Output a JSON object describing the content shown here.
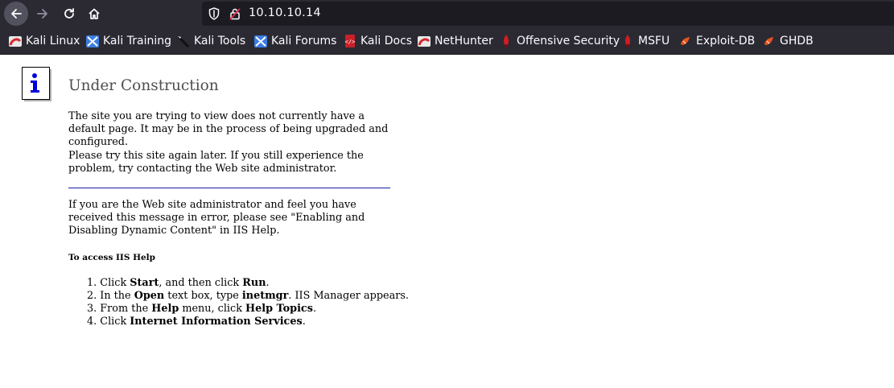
{
  "browser": {
    "url": "10.10.10.14",
    "bookmarks": [
      {
        "label": "Kali Linux",
        "icon": "kali-icon"
      },
      {
        "label": "Kali Training",
        "icon": "kali-training-icon"
      },
      {
        "label": "Kali Tools",
        "icon": "kali-tools-icon"
      },
      {
        "label": "Kali Forums",
        "icon": "kali-forums-icon"
      },
      {
        "label": "Kali Docs",
        "icon": "kali-docs-icon"
      },
      {
        "label": "NetHunter",
        "icon": "nethunter-icon"
      },
      {
        "label": "Offensive Security",
        "icon": "offsec-icon"
      },
      {
        "label": "MSFU",
        "icon": "msfu-icon"
      },
      {
        "label": "Exploit-DB",
        "icon": "exploitdb-icon"
      },
      {
        "label": "GHDB",
        "icon": "ghdb-icon"
      }
    ]
  },
  "page": {
    "title": "Under Construction",
    "para1": "The site you are trying to view does not currently have a default page. It may be in the process of being upgraded and configured.",
    "para2": "Please try this site again later. If you still experience the problem, try contacting the Web site administrator.",
    "para3": "If you are the Web site administrator and feel you have received this message in error, please see \"Enabling and Disabling Dynamic Content\" in IIS Help.",
    "help_heading": "To access IIS Help",
    "steps": [
      {
        "n": "1.",
        "a": "Click ",
        "b1": "Start",
        "c": ", and then click ",
        "b2": "Run",
        "d": "."
      },
      {
        "n": "2.",
        "a": "In the ",
        "b1": "Open",
        "c": " text box, type ",
        "b2": "inetmgr",
        "d": ". IIS Manager appears."
      },
      {
        "n": "3.",
        "a": "From the ",
        "b1": "Help",
        "c": " menu, click ",
        "b2": "Help Topics",
        "d": "."
      },
      {
        "n": "4.",
        "a": "Click ",
        "b1": "Internet Information Services",
        "c": "",
        "b2": "",
        "d": "."
      }
    ]
  }
}
